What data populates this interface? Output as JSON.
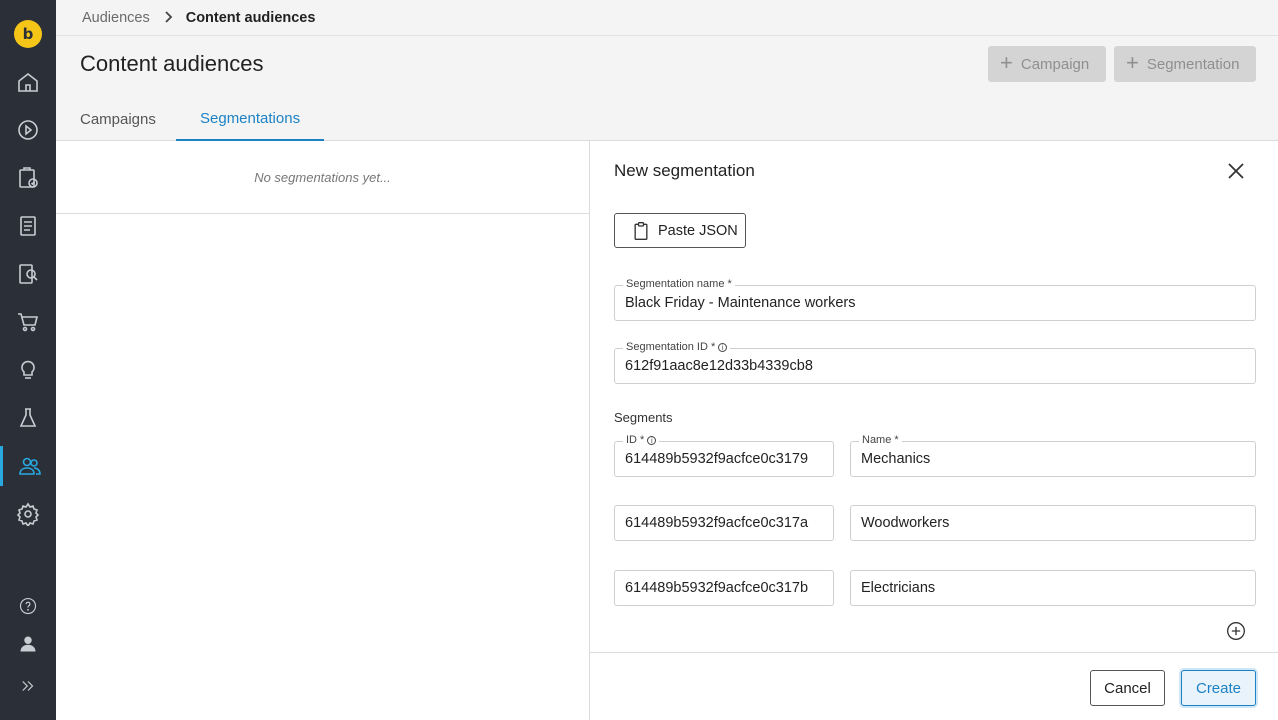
{
  "sidebar": {
    "logo_text": "b",
    "accent_color": "#29a8e0",
    "items": [
      {
        "icon": "home-icon"
      },
      {
        "icon": "play-icon"
      },
      {
        "icon": "clipboard-check-icon"
      },
      {
        "icon": "document-icon"
      },
      {
        "icon": "document-search-icon"
      },
      {
        "icon": "cart-icon"
      },
      {
        "icon": "lightbulb-icon"
      },
      {
        "icon": "flask-icon"
      },
      {
        "icon": "audience-icon",
        "active": true
      },
      {
        "icon": "gear-icon"
      },
      {
        "icon": "help-icon"
      },
      {
        "icon": "user-icon"
      },
      {
        "icon": "expand-icon"
      }
    ]
  },
  "breadcrumb": {
    "parent": "Audiences",
    "separator": ">",
    "current": "Content audiences"
  },
  "page": {
    "title": "Content audiences"
  },
  "actions": {
    "campaign_label": "Campaign",
    "segmentation_label": "Segmentation"
  },
  "tabs": [
    {
      "label": "Campaigns",
      "active": false
    },
    {
      "label": "Segmentations",
      "active": true
    }
  ],
  "list": {
    "empty_text": "No segmentations yet..."
  },
  "form": {
    "title": "New segmentation",
    "paste_json_label": "Paste JSON",
    "segmentation_name": {
      "label": "Segmentation name *",
      "value": "Black Friday - Maintenance workers"
    },
    "segmentation_id": {
      "label": "Segmentation ID *",
      "value": "612f91aac8e12d33b4339cb8"
    },
    "segments_label": "Segments",
    "segment_id_label": "ID *",
    "segment_name_label": "Name *",
    "segments": [
      {
        "id": "614489b5932f9acfce0c3179",
        "name": "Mechanics"
      },
      {
        "id": "614489b5932f9acfce0c317a",
        "name": "Woodworkers"
      },
      {
        "id": "614489b5932f9acfce0c317b",
        "name": "Electricians"
      }
    ],
    "cancel_label": "Cancel",
    "create_label": "Create"
  }
}
